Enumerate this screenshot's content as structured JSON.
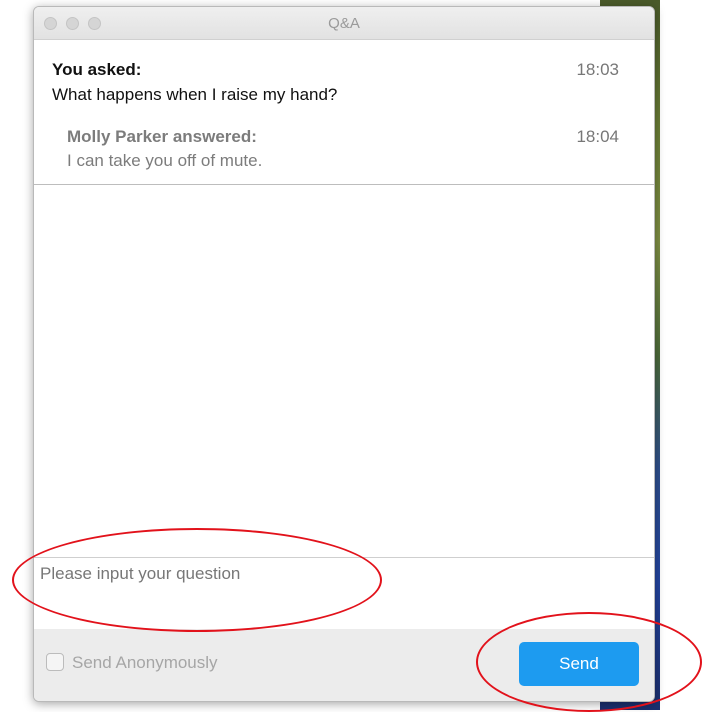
{
  "window": {
    "title": "Q&A"
  },
  "question": {
    "author_label": "You asked:",
    "time": "18:03",
    "text": "What happens when I raise my hand?"
  },
  "answer": {
    "author_label": "Molly Parker answered:",
    "time": "18:04",
    "text": "I can take you off of mute."
  },
  "input": {
    "placeholder": "Please input your question",
    "value": ""
  },
  "footer": {
    "anonymous_label": "Send Anonymously",
    "anonymous_checked": false,
    "send_label": "Send"
  },
  "colors": {
    "send_button": "#1d9bf0",
    "annotation": "#e2121b"
  }
}
